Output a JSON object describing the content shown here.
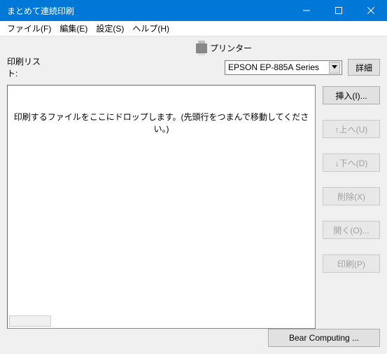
{
  "window": {
    "title": "まとめて連続印刷"
  },
  "menu": {
    "file": "ファイル(F)",
    "edit": "編集(E)",
    "settings": "設定(S)",
    "help": "ヘルプ(H)"
  },
  "labels": {
    "printer": "プリンター",
    "print_list": "印刷リスト:",
    "details": "詳細",
    "drop_message": "印刷するファイルをここにドロップします。(先頭行をつまんで移動してください。)"
  },
  "printer": {
    "selected": "EPSON EP-885A Series"
  },
  "buttons": {
    "insert": "挿入(I)...",
    "up": "↑上へ(U)",
    "down": "↓下へ(D)",
    "delete": "削除(X)",
    "open": "開く(O)...",
    "print": "印刷(P)",
    "footer": "Bear Computing ..."
  }
}
